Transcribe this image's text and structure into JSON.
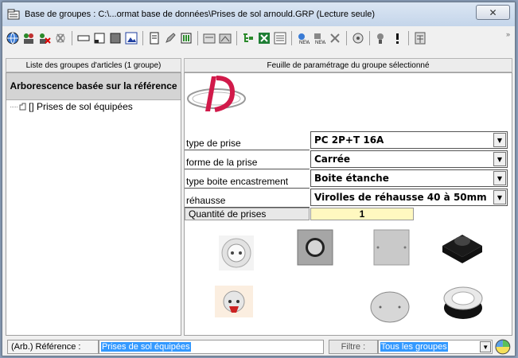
{
  "window": {
    "title": "Base de groupes : C:\\...ormat base de données\\Prises de sol arnould.GRP (Lecture seule)",
    "close_symbol": "✕"
  },
  "toolbar": {
    "icons": [
      "globe-icon",
      "group-add-icon",
      "group-delete-icon",
      "clear-icon",
      "field-icon",
      "window-icon",
      "color-icon",
      "image-edit-icon",
      "document-icon",
      "edit-icon",
      "tag-icon",
      "export-icon",
      "import-icon",
      "tree-icon",
      "excel-icon",
      "list-icon",
      "new-field-icon",
      "new-group-icon",
      "delete-icon",
      "view-icon",
      "search-icon",
      "alert-icon",
      "calculator-icon"
    ],
    "more": "»"
  },
  "left_panel": {
    "header": "Liste des groupes d'articles (1 groupe)",
    "tree_title": "Arborescence basée sur la référence",
    "items": [
      {
        "label": "[] Prises de sol équipées"
      }
    ]
  },
  "right_panel": {
    "header": "Feuille de paramétrage du groupe sélectionné",
    "logo_text": "ID",
    "params": [
      {
        "label": "type de prise",
        "value": "PC 2P+T 16A"
      },
      {
        "label": "forme de la prise",
        "value": "Carrée"
      },
      {
        "label": "type boite encastrement",
        "value": "Boite étanche"
      },
      {
        "label": "réhausse",
        "value": "Virolles de réhausse 40 à 50mm"
      }
    ],
    "quantity": {
      "label": "Quantité de prises",
      "value": "1"
    }
  },
  "status": {
    "ref_label": "(Arb.) Référence :",
    "ref_value": "Prises de sol équipées",
    "filter_label": "Filtre :",
    "filter_value": "Tous les groupes"
  }
}
